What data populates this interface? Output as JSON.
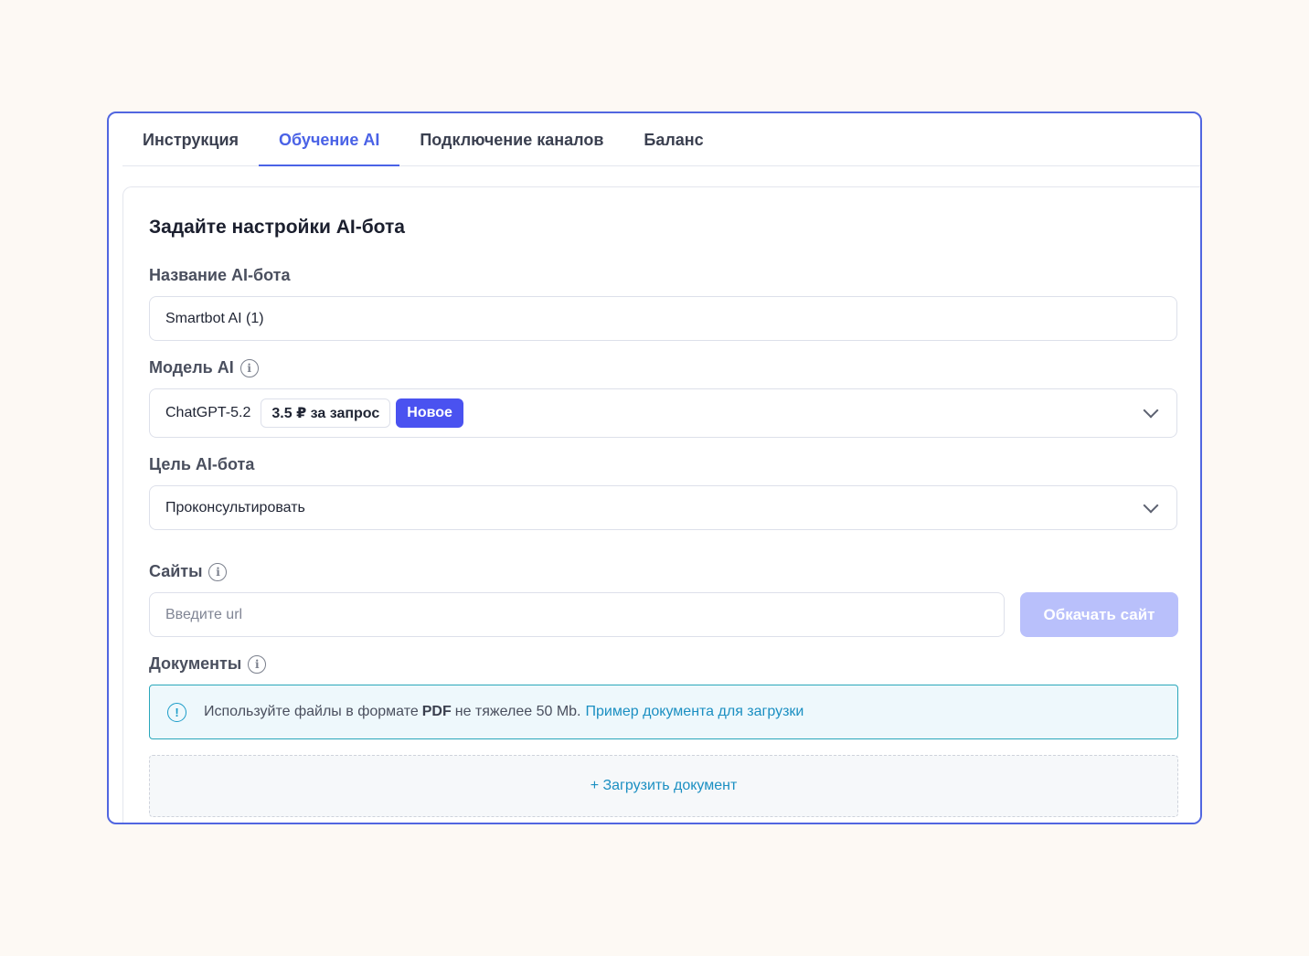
{
  "tabs": [
    {
      "label": "Инструкция",
      "active": false
    },
    {
      "label": "Обучение AI",
      "active": true
    },
    {
      "label": "Подключение каналов",
      "active": false
    },
    {
      "label": "Баланс",
      "active": false
    }
  ],
  "form": {
    "title": "Задайте настройки AI-бота",
    "bot_name": {
      "label": "Название AI-бота",
      "value": "Smartbot AI (1)"
    },
    "model": {
      "label": "Модель AI",
      "value": "ChatGPT-5.2",
      "price": "3.5 ₽ за запрос",
      "badge": "Новое"
    },
    "goal": {
      "label": "Цель AI-бота",
      "value": "Проконсультировать"
    },
    "sites": {
      "label": "Сайты",
      "placeholder": "Введите url",
      "button": "Обкачать сайт"
    },
    "documents": {
      "label": "Документы",
      "notice_prefix": "Используйте файлы в формате",
      "notice_format": "PDF",
      "notice_suffix": "не тяжелее 50 Mb.",
      "notice_link": "Пример документа для загрузки",
      "upload": "+ Загрузить документ"
    }
  },
  "colors": {
    "accent": "#4a62e6",
    "frame_border": "#5166e0",
    "badge_new": "#4a52f0",
    "button_disabled": "#b9c0fb",
    "link": "#1b8fc2",
    "notice_border": "#2aa7bb"
  },
  "icons": {
    "info": "info-circle-icon",
    "alert": "exclamation-circle-icon",
    "dropdown": "chevron-down-icon"
  }
}
